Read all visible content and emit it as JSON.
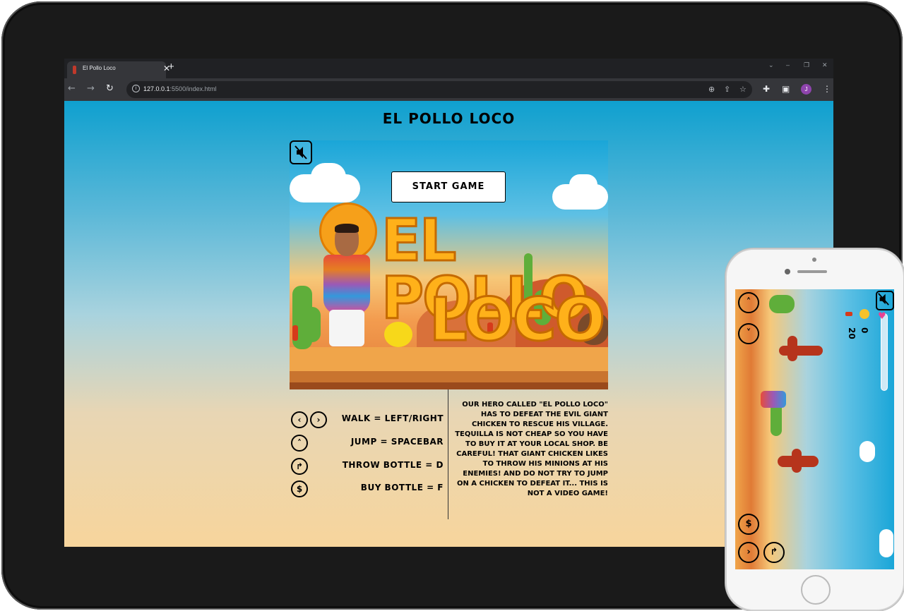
{
  "browser": {
    "tab_title": "El Pollo Loco",
    "tab_close": "✕",
    "new_tab": "+",
    "url_host": "127.0.0.1",
    "url_rest": ":5500/index.html",
    "profile_initial": "J",
    "win_controls": [
      "⌄",
      "–",
      "❐",
      "✕"
    ]
  },
  "page": {
    "heading": "EL POLLO LOCO",
    "start_button": "START GAME",
    "logo_line1": "EL POLLO",
    "logo_line2": "LOCO",
    "controls": [
      {
        "icons": [
          "‹",
          "›"
        ],
        "label": "WALK = LEFT/RIGHT"
      },
      {
        "icons": [
          "˄"
        ],
        "label": "JUMP = SPACEBAR"
      },
      {
        "icons": [
          "↱"
        ],
        "label": "THROW BOTTLE = D"
      },
      {
        "icons": [
          "$"
        ],
        "label": "BUY BOTTLE = F"
      }
    ],
    "story": "Our hero called \"El Pollo Loco\" has to defeat the evil giant chicken to rescue his village. Tequilla is not cheap so you have to buy it at your local shop. Be careful! That giant chicken likes to throw his minions at his enemies! And do not try to jump on a chicken to defeat it... This is not a video game!"
  },
  "phone": {
    "coins": "0",
    "bottles": "20"
  },
  "colors": {
    "sky_top": "#0fa0cf",
    "sand": "#f7d59c",
    "logo_fill": "#ffb11a",
    "browser_dark": "#202124"
  }
}
